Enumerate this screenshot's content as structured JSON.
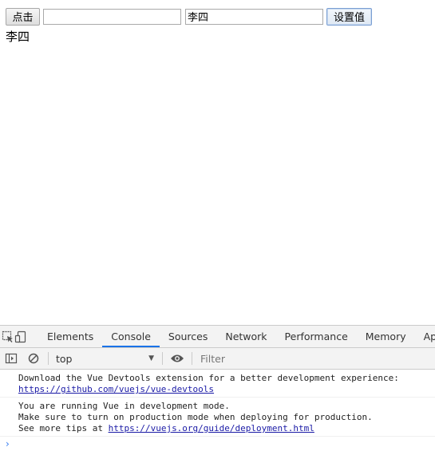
{
  "page": {
    "click_button_label": "点击",
    "input1_value": "",
    "input2_value": "李四",
    "set_value_button_label": "设置值",
    "display_text": "李四"
  },
  "devtools": {
    "tabs": [
      {
        "label": "Elements",
        "active": false
      },
      {
        "label": "Console",
        "active": true
      },
      {
        "label": "Sources",
        "active": false
      },
      {
        "label": "Network",
        "active": false
      },
      {
        "label": "Performance",
        "active": false
      },
      {
        "label": "Memory",
        "active": false
      },
      {
        "label": "Applica",
        "active": false
      }
    ],
    "toolbar": {
      "context": "top",
      "filter_placeholder": "Filter"
    },
    "console_messages": [
      {
        "line1": "Download the Vue Devtools extension for a better development experience:",
        "link": "https://github.com/vuejs/vue-devtools"
      },
      {
        "line1": "You are running Vue in development mode.",
        "line2": "Make sure to turn on production mode when deploying for production.",
        "line3_prefix": "See more tips at ",
        "link": "https://vuejs.org/guide/deployment.html"
      }
    ],
    "prompt_symbol": "›"
  },
  "colors": {
    "accent": "#1a73e8",
    "link": "#1a1aa6",
    "prompt": "#367cf1"
  }
}
